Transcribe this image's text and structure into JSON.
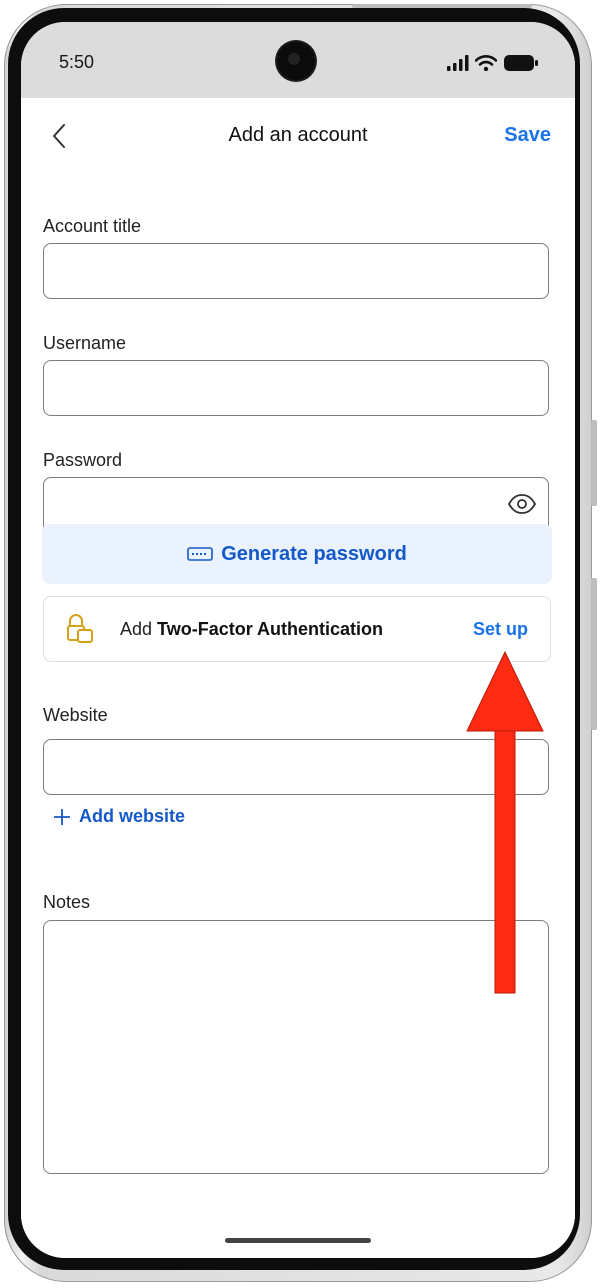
{
  "status": {
    "time": "5:50",
    "icons": [
      "signal-icon",
      "wifi-icon",
      "battery-icon"
    ]
  },
  "nav": {
    "back_icon": "chevron-left-icon",
    "title": "Add an account",
    "save_label": "Save"
  },
  "form": {
    "account_title": {
      "label": "Account title",
      "value": ""
    },
    "username": {
      "label": "Username",
      "value": ""
    },
    "password": {
      "label": "Password",
      "value": "",
      "visibility_icon": "eye-icon"
    },
    "generate_password": {
      "label": "Generate password",
      "icon": "keyboard-icon"
    },
    "two_factor": {
      "prefix": "Add",
      "bold_text": "Two-Factor Authentication",
      "action_label": "Set up",
      "icon": "lock-icon"
    },
    "website": {
      "label": "Website",
      "value": ""
    },
    "add_website": {
      "label": "Add website",
      "icon": "plus-icon"
    },
    "notes": {
      "label": "Notes",
      "value": ""
    }
  },
  "annotation": {
    "type": "red-arrow-up",
    "color": "#ff2a12"
  },
  "colors": {
    "accent": "#1a73e8",
    "generate_bg": "#eaf3fd",
    "lock": "#d4a21a"
  }
}
